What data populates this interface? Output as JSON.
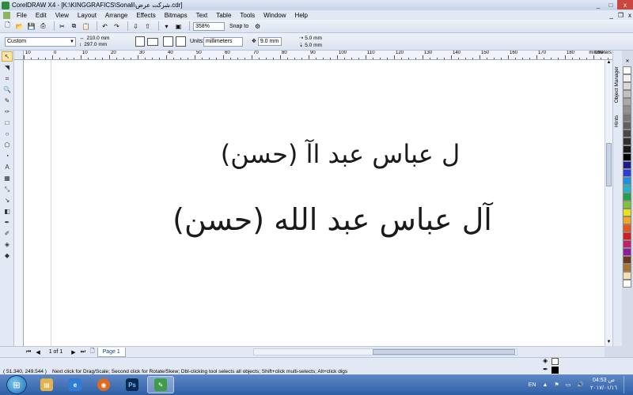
{
  "window": {
    "title": "CorelDRAW X4 - [K:\\KINGGRAFICS\\Sonali\\شركت عرض.cdr]",
    "controls": [
      "_",
      "□",
      "x"
    ]
  },
  "menubar": {
    "items": [
      "File",
      "Edit",
      "View",
      "Layout",
      "Arrange",
      "Effects",
      "Bitmaps",
      "Text",
      "Table",
      "Tools",
      "Window",
      "Help"
    ],
    "doc_controls": [
      "_",
      "❐",
      "x"
    ]
  },
  "toolbar": {
    "zoom": "358%",
    "snap_to": "Snap to"
  },
  "property_bar": {
    "page_preset": "Custom",
    "page_width": "210.0 mm",
    "page_height": "297.0 mm",
    "units_label": "Units:",
    "units": "millimeters",
    "nudge": "9.0 mm",
    "dup_x": "5.0 mm",
    "dup_y": "5.0 mm"
  },
  "ruler": {
    "labels": [
      "10",
      "0",
      "10",
      "20",
      "30",
      "40",
      "50",
      "60",
      "70",
      "80",
      "90",
      "100",
      "110",
      "120",
      "130",
      "140",
      "150",
      "160",
      "170",
      "180",
      "190"
    ],
    "unit": "millimeters"
  },
  "canvas": {
    "line1": "ل عباس عبد اآ (حسن)",
    "line2": "آل عباس عبد الله (حسن)"
  },
  "docker": {
    "tabs": [
      "Object Manager",
      "Hints"
    ]
  },
  "palette": {
    "colors": [
      "#ffffff",
      "#f0f0f0",
      "#d8d8d8",
      "#c0c0c0",
      "#a8a8a8",
      "#909090",
      "#787878",
      "#606060",
      "#484848",
      "#303030",
      "#181818",
      "#000000",
      "#1b1b8f",
      "#2a3bd6",
      "#1f8fe0",
      "#22b2c9",
      "#1fa24a",
      "#7cc43a",
      "#e8e21c",
      "#f4a51c",
      "#e8551c",
      "#d61c1c",
      "#c81c6e",
      "#8f1c9a",
      "#6b3a1c",
      "#a8742e",
      "#f5dfb0",
      "#ffffff"
    ]
  },
  "pagebar": {
    "page_count": "1 of 1",
    "page_tab": "Page 1"
  },
  "status": {
    "coords": "( 51.340, 249.544 )",
    "hint": "Next click for Drag/Scale; Second click for Rotate/Skew; Dbl-clicking tool selects all objects; Shift+click multi-selects; Alt+click digs"
  },
  "taskbar": {
    "apps": [
      "Windows Explorer",
      "Internet Explorer",
      "Firefox",
      "Photoshop",
      "CorelDRAW"
    ],
    "language": "EN",
    "time": "04:53",
    "ampm": "ص",
    "date": "٢٠١٧/٠١/١٦"
  }
}
